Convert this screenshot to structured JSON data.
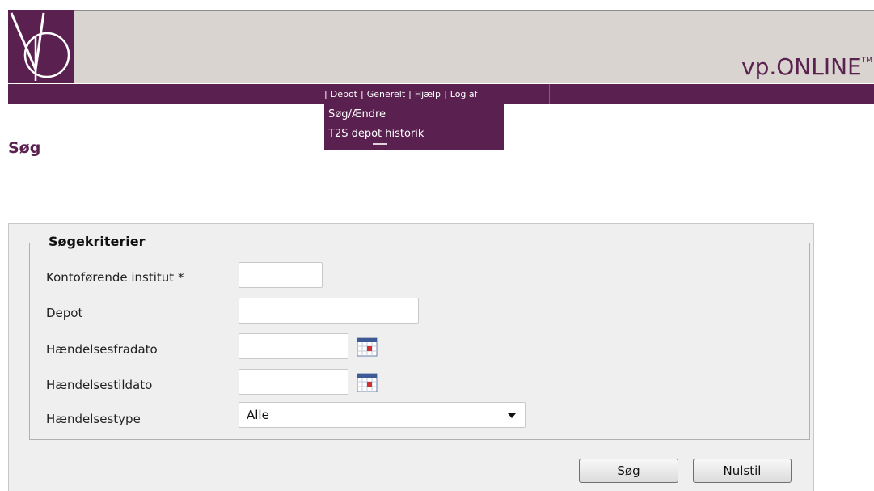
{
  "brand": {
    "name": "vp.ONLINE",
    "tm": "TM"
  },
  "menu": {
    "items": [
      "Depot",
      "Generelt",
      "Hjælp",
      "Log af"
    ],
    "dropdown": [
      "Søg/Ændre",
      "T2S depot historik"
    ]
  },
  "page": {
    "title": "Søg"
  },
  "form": {
    "legend": "Søgekriterier",
    "fields": {
      "institut": {
        "label": "Kontoførende institut *",
        "value": ""
      },
      "depot": {
        "label": "Depot",
        "value": ""
      },
      "fradato": {
        "label": "Hændelsesfradato",
        "value": ""
      },
      "tildato": {
        "label": "Hændelsestildato",
        "value": ""
      },
      "type": {
        "label": "Hændelsestype",
        "value": "Alle"
      }
    },
    "buttons": {
      "search": "Søg",
      "reset": "Nulstil"
    }
  },
  "colors": {
    "brand": "#5a2150",
    "header_bg": "#d9d4d0",
    "panel_bg": "#efefef"
  },
  "icons": {
    "calendar": "calendar-icon",
    "dropdown": "chevron-down-icon",
    "logo": "vp-logo"
  }
}
